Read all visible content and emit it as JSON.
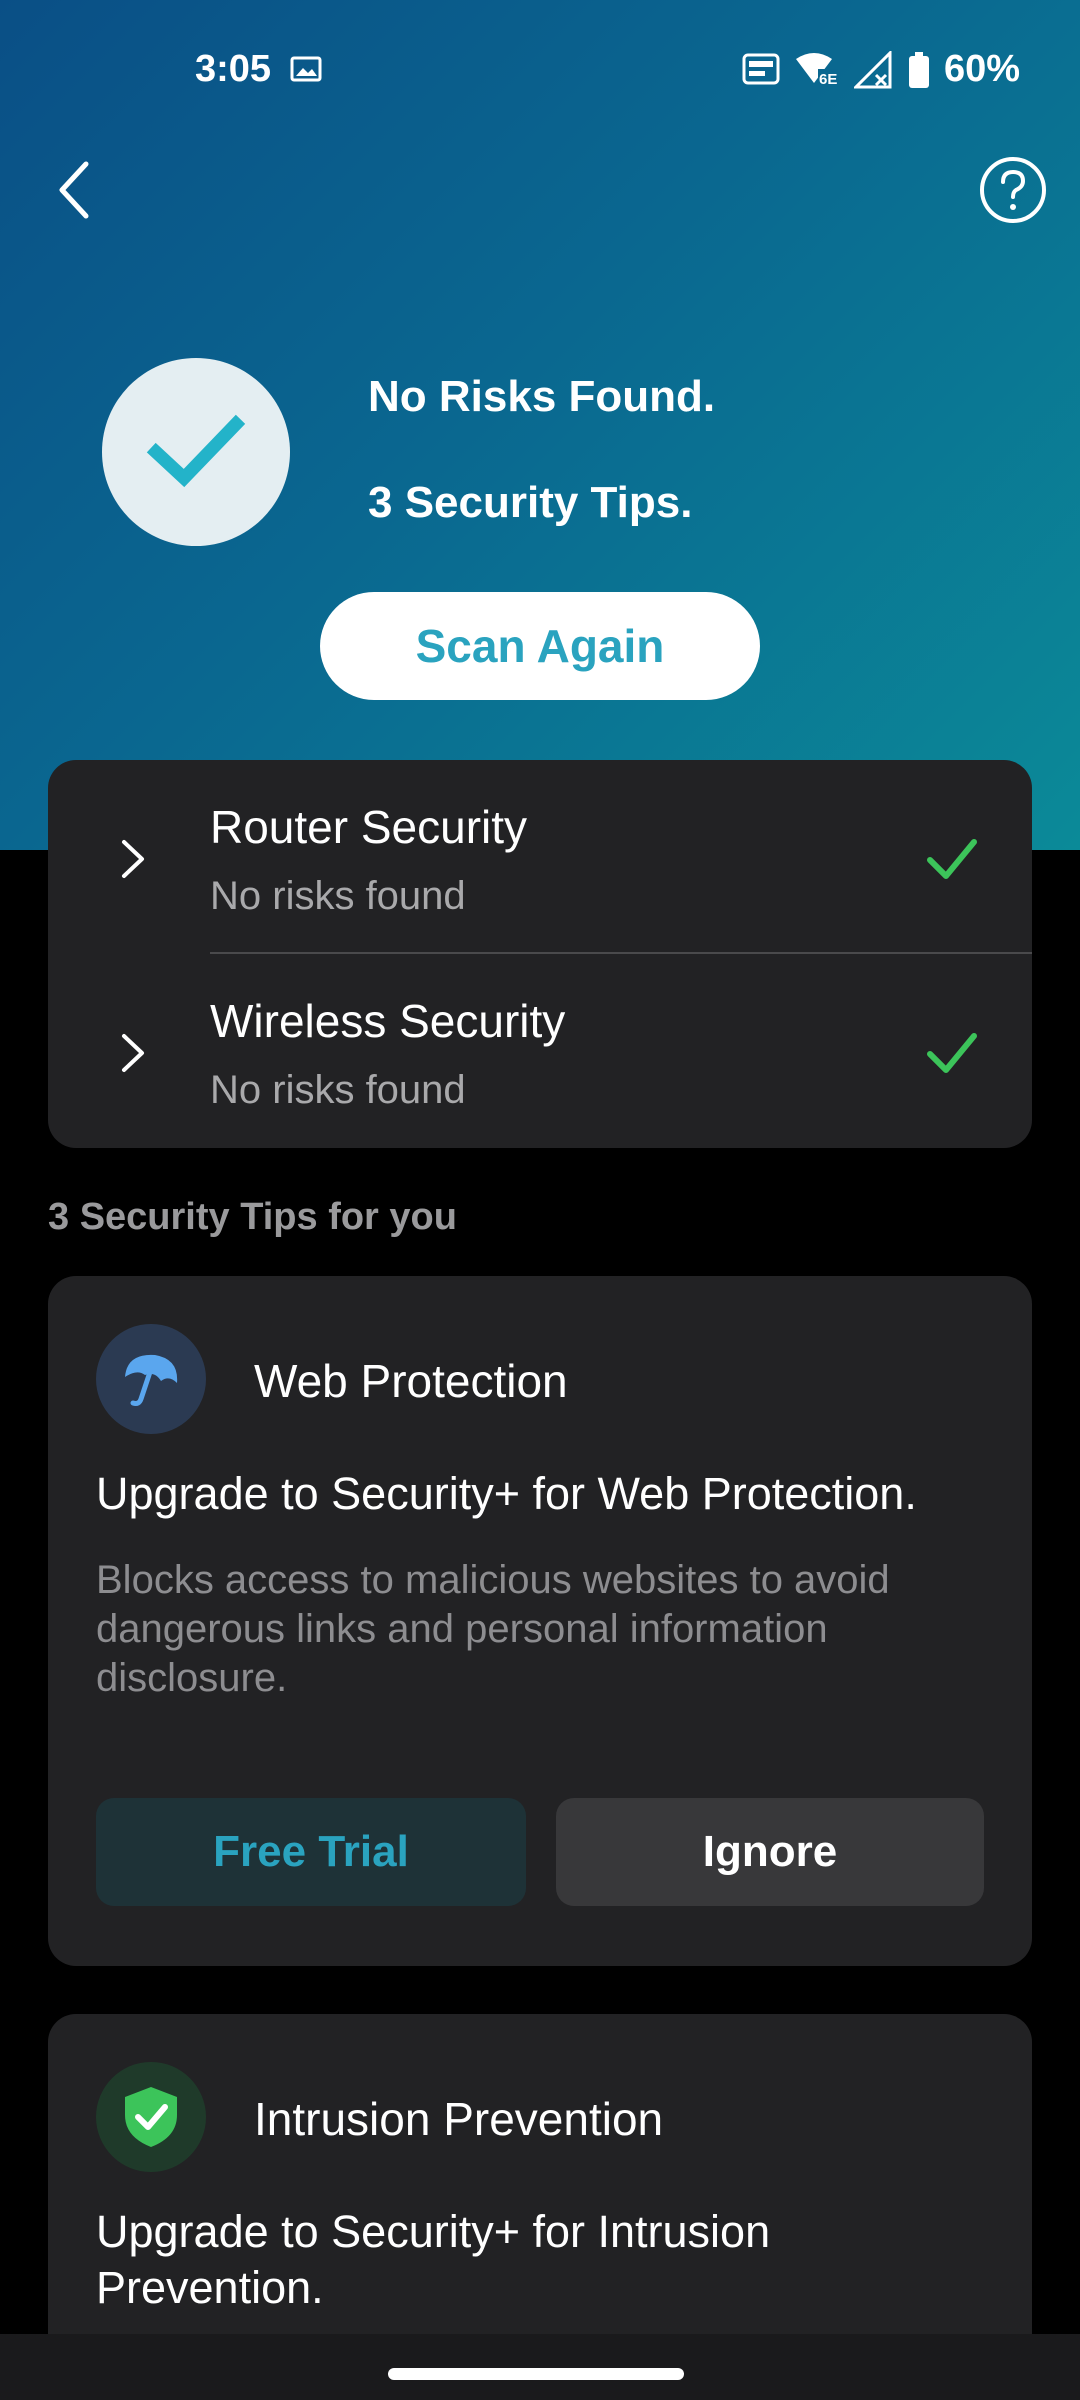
{
  "status_bar": {
    "time": "3:05",
    "battery_percent": "60%",
    "icons": [
      "image-icon",
      "auto-hz-icon",
      "wifi-6e-icon",
      "no-signal-icon",
      "battery-icon"
    ]
  },
  "nav": {
    "back_icon": "chevron-left-icon",
    "help_icon": "help-circle-icon"
  },
  "summary": {
    "line1": "No Risks Found.",
    "line2": "3 Security Tips.",
    "scan_button": "Scan Again"
  },
  "security_items": [
    {
      "title": "Router Security",
      "status": "No risks found"
    },
    {
      "title": "Wireless Security",
      "status": "No risks found"
    }
  ],
  "tips_heading": "3 Security Tips for you",
  "tips": [
    {
      "title": "Web Protection",
      "headline": "Upgrade to Security+ for Web Protection.",
      "description": "Blocks access to malicious websites to avoid dangerous links and personal information disclosure.",
      "primary_button": "Free Trial",
      "secondary_button": "Ignore",
      "icon": "umbrella-icon"
    },
    {
      "title": "Intrusion Prevention",
      "headline": "Upgrade to Security+ for Intrusion Prevention.",
      "icon": "shield-check-icon"
    }
  ],
  "colors": {
    "accent": "#2aa3bf",
    "success": "#3cc45a",
    "card": "#222224",
    "gradient_start": "#0a4f86",
    "gradient_end": "#0b8a98"
  }
}
